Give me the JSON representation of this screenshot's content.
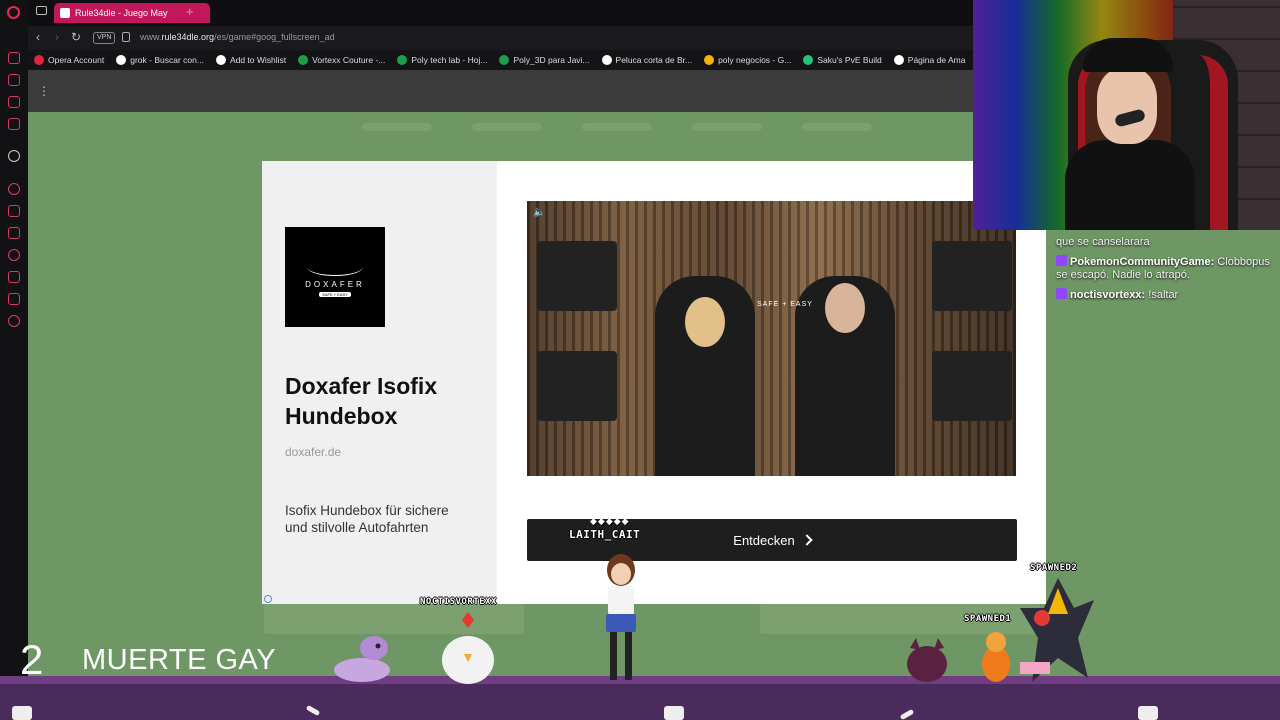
{
  "browser": {
    "tab": {
      "title": "Rule34dle - Juego May"
    },
    "url_prefix": "www.",
    "url_domain": "rule34dle.org",
    "url_path": "/es/game#goog_fullscreen_ad",
    "vpn_label": "VPN",
    "bookmarks": [
      {
        "label": "Opera Account",
        "color": "#e0263f"
      },
      {
        "label": "grok - Buscar con...",
        "color": "#ffffff"
      },
      {
        "label": "Add to Wishlist",
        "color": "#ffffff"
      },
      {
        "label": "Vortexx Couture -...",
        "color": "#1e9e4a"
      },
      {
        "label": "Poly tech lab - Hoj...",
        "color": "#1e9e4a"
      },
      {
        "label": "Poly_3D para Javi...",
        "color": "#1e9e4a"
      },
      {
        "label": "Peluca corta de Br...",
        "color": "#ffffff"
      },
      {
        "label": "poly negocios - G...",
        "color": "#f4b400"
      },
      {
        "label": "Saku's PvE Build",
        "color": "#22c37a"
      },
      {
        "label": "Página de Ama",
        "color": "#ffffff"
      }
    ]
  },
  "ad": {
    "logo_name": "DOXAFER",
    "logo_tagline": "SAFE + EASY",
    "title": "Doxafer Isofix Hundebox",
    "domain": "doxafer.de",
    "description": "Isofix Hundebox für sichere und stilvolle Autofahrten",
    "video_brand": "SAFE + EASY",
    "cta_label": "Entdecken"
  },
  "chat": {
    "messages": [
      {
        "user": "",
        "text": "que se canselarara"
      },
      {
        "user": "PokemonCommunityGame:",
        "text": "Clobbopus se escapó. Nadie lo atrapó."
      },
      {
        "user": "noctisvortexx:",
        "text": "!saltar"
      }
    ]
  },
  "overlay": {
    "number": "2",
    "message": "MUERTE GAY",
    "sprite_tags": {
      "laith": "LAITH_CAIT",
      "noctis": "NOCTISVORTEXX",
      "spawned1": "SPAWNED1",
      "spawned2": "SPAWNED2"
    },
    "hearts": "◆◆◆◆◆"
  }
}
